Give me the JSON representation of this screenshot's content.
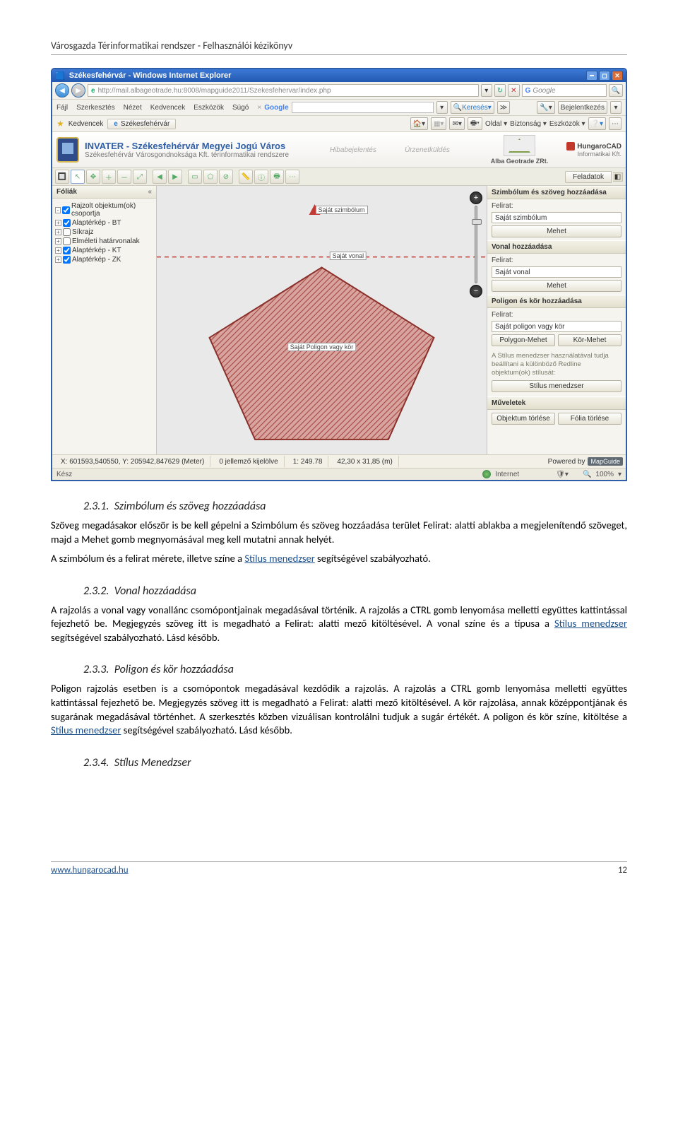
{
  "doc": {
    "header": "Városgazda Térinformatikai rendszer - Felhasználói kézikönyv",
    "footer_link": "www.hungarocad.hu",
    "footer_page": "12"
  },
  "ie": {
    "title": "Székesfehérvár - Windows Internet Explorer",
    "url": "http://mail.albageotrade.hu:8008/mapguide2011/Szekesfehervar/index.php",
    "search_placeholder": "Google",
    "search_button": "Keresés",
    "login": "Bejelentkezés",
    "menus": [
      "Fájl",
      "Szerkesztés",
      "Nézet",
      "Kedvencek",
      "Eszközök",
      "Súgó"
    ],
    "google_label": "Google",
    "favorites": "Kedvencek",
    "tab_label": "Székesfehérvár",
    "tabtools": [
      "Oldal",
      "Biztonság",
      "Eszközök"
    ],
    "status_ready": "Kész",
    "status_zone": "Internet",
    "status_zoom": "100%"
  },
  "app": {
    "title": "INVATER - Székesfehérvár Megyei Jogú Város",
    "subtitle": "Székesfehérvár Városgondnoksága Kft. térinformatikai rendszere",
    "mid1": "Hibabejelentés",
    "mid2": "Ürzenetküldés",
    "alba": "Alba Geotrade ZRt.",
    "hcad1": "HungaroCAD",
    "hcad2": "Informatikai Kft.",
    "feladatok": "Feladatok"
  },
  "left": {
    "head": "Fóliák",
    "items": [
      {
        "label": "Rajzolt objektum(ok) csoportja",
        "exp": "-"
      },
      {
        "label": "Alaptérkép - BT",
        "exp": "+"
      },
      {
        "label": "Síkrajz",
        "exp": "+"
      },
      {
        "label": "Elméleti határvonalak",
        "exp": "+"
      },
      {
        "label": "Alaptérkép - KT",
        "exp": "+"
      },
      {
        "label": "Alaptérkép - ZK",
        "exp": "+"
      }
    ]
  },
  "map": {
    "sym": "Saját szimbólum",
    "line": "Saját vonal",
    "poly": "Saját Poligon vagy kör"
  },
  "right": {
    "h1": "Szimbólum és szöveg hozzáadása",
    "felirat": "Felirat:",
    "v_sym": "Saját szimbólum",
    "mehet": "Mehet",
    "h2": "Vonal hozzáadása",
    "v_line": "Saját vonal",
    "h3": "Poligon és kör hozzáadása",
    "v_poly": "Saját poligon vagy kör",
    "poly_btn": "Polygon-Mehet",
    "kor_btn": "Kör-Mehet",
    "hint": "A Stílus menedzser használatával tudja beállítani a különböző Redline objektum(ok) stílusát:",
    "stylemgr": "Stílus menedzser",
    "h4": "Műveletek",
    "del_obj": "Objektum törlése",
    "del_foil": "Fólia törlése"
  },
  "status": {
    "coord": "X: 601593,540550, Y: 205942,847629 (Meter)",
    "sel": "0 jellemző kijelölve",
    "scale": "1: 249.78",
    "dim": "42,30 x 31,85 (m)",
    "powered": "Powered by",
    "mg": "MapGuide"
  },
  "sections": {
    "s1_num": "2.3.1.",
    "s1_title": "Szimbólum és szöveg hozzáadása",
    "s1_p": "Szöveg megadásakor először is be kell gépelni a Szimbólum és szöveg hozzáadása terület Felirat: alatti ablakba a megjelenítendő szöveget, majd a Mehet gomb megnyomásával meg kell mutatni annak helyét.",
    "s1_p2a": "A szimbólum és a felirat mérete, illetve színe a ",
    "s1_link": "Stílus menedzser",
    "s1_p2b": " segítségével szabályozható.",
    "s2_num": "2.3.2.",
    "s2_title": "Vonal hozzáadása",
    "s2_p_a": "A rajzolás a vonal vagy vonallánc csomópontjainak megadásával történik. A rajzolás a CTRL gomb lenyomása melletti együttes kattintással fejezhető be. Megjegyzés szöveg itt is megadható a Felirat: alatti mező kitöltésével. A vonal színe és a típusa a ",
    "s2_p_b": " segítségével szabályozható. Lásd később.",
    "s3_num": "2.3.3.",
    "s3_title": "Poligon és kör hozzáadása",
    "s3_p_a": "Poligon rajzolás esetben is a csomópontok megadásával kezdődik a rajzolás. A rajzolás a CTRL gomb lenyomása melletti együttes kattintással fejezhető be. Megjegyzés szöveg itt is megadható a Felirat: alatti mező kitöltésével. A kör rajzolása, annak középpontjának és sugarának megadásával történhet. A szerkesztés közben vizuálisan kontrolálni tudjuk a sugár értékét. A poligon és kör színe, kitöltése a ",
    "s3_p_b": " segítségével szabályozható. Lásd később.",
    "s4_num": "2.3.4.",
    "s4_title": "Stílus Menedzser"
  }
}
